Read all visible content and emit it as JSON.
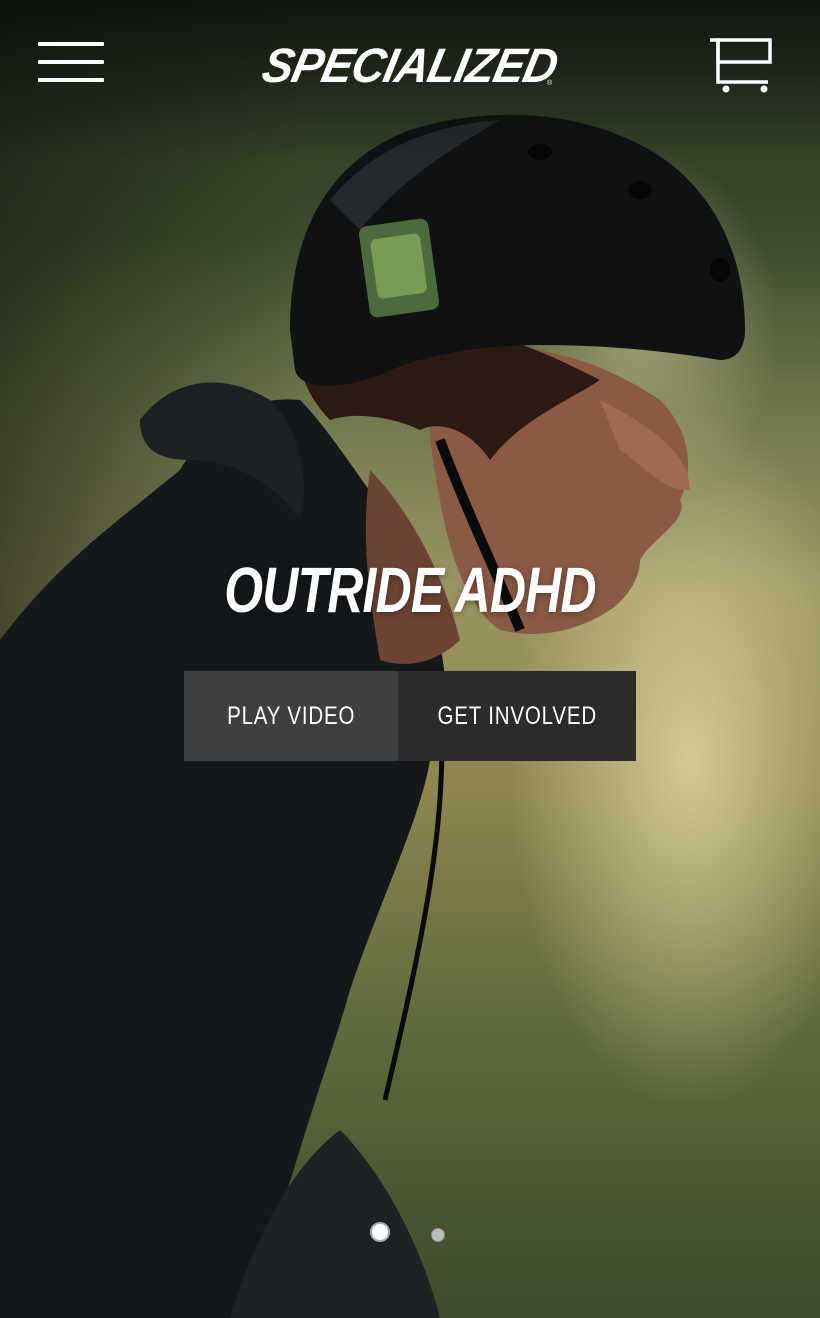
{
  "header": {
    "logo_text": "SPECIALIZED",
    "logo_mark": "®",
    "menu_icon": "hamburger-menu-icon",
    "cart_icon": "shopping-cart-icon"
  },
  "hero": {
    "title": "OUTRIDE ADHD",
    "buttons": {
      "play_video": "PLAY VIDEO",
      "get_involved": "GET INVOLVED"
    },
    "background_image": "skate-park-rider-with-helmet"
  },
  "carousel": {
    "slide_count": 2,
    "active_slide": 1
  },
  "colors": {
    "text": "#ffffff",
    "play_button_bg": "#3f3f3f",
    "involve_button_bg": "#2b2b2b"
  }
}
